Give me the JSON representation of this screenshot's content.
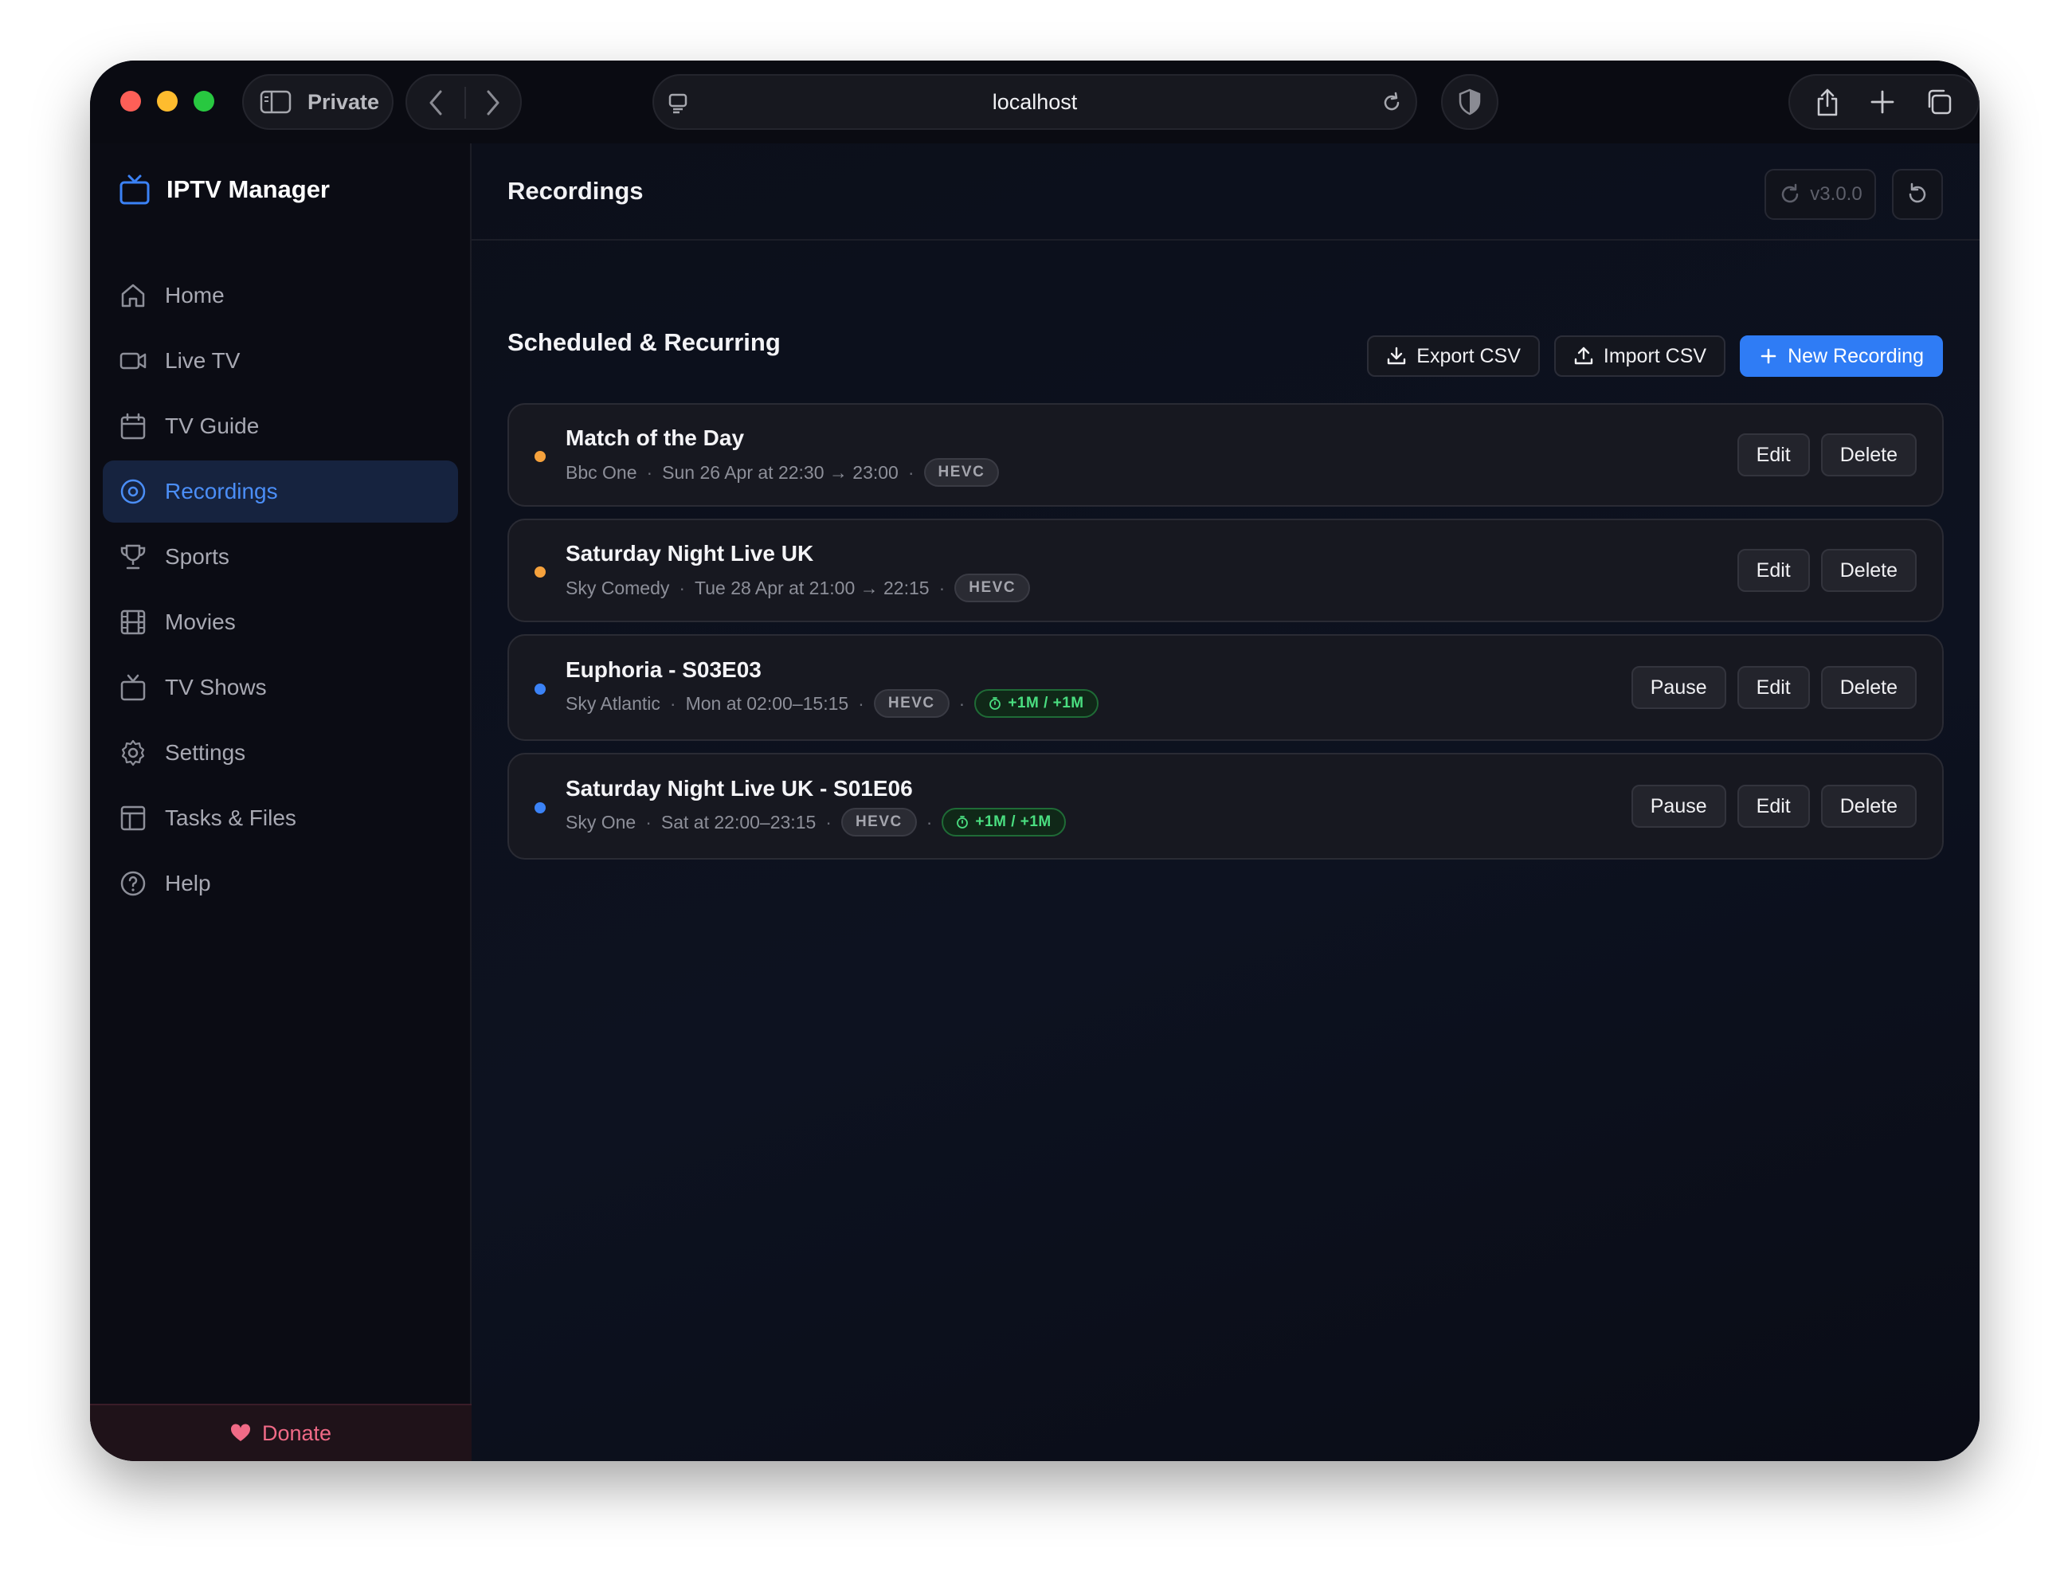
{
  "browser": {
    "private_label": "Private",
    "url": "localhost"
  },
  "app": {
    "name": "IPTV Manager",
    "accent_color": "#2f7cf5"
  },
  "sidebar": {
    "items": [
      {
        "label": "Home",
        "icon": "home-icon",
        "active": false
      },
      {
        "label": "Live TV",
        "icon": "video-camera-icon",
        "active": false
      },
      {
        "label": "TV Guide",
        "icon": "calendar-icon",
        "active": false
      },
      {
        "label": "Recordings",
        "icon": "record-icon",
        "active": true
      },
      {
        "label": "Sports",
        "icon": "trophy-icon",
        "active": false
      },
      {
        "label": "Movies",
        "icon": "film-icon",
        "active": false
      },
      {
        "label": "TV Shows",
        "icon": "tv-icon",
        "active": false
      },
      {
        "label": "Settings",
        "icon": "gear-icon",
        "active": false
      },
      {
        "label": "Tasks & Files",
        "icon": "layout-icon",
        "active": false
      },
      {
        "label": "Help",
        "icon": "help-circle-icon",
        "active": false
      }
    ],
    "donate_label": "Donate"
  },
  "header": {
    "title": "Recordings",
    "version": "v3.0.0"
  },
  "section": {
    "title": "Scheduled & Recurring",
    "export_label": "Export CSV",
    "import_label": "Import CSV",
    "new_label": "New Recording"
  },
  "recordings": [
    {
      "title": "Match of the Day",
      "channel": "Bbc One",
      "schedule": "Sun 26 Apr at 22:30 → 23:00",
      "codec": "HEVC",
      "padding": "",
      "status_color": "orange",
      "actions": {
        "pause": "",
        "edit": "Edit",
        "delete": "Delete"
      }
    },
    {
      "title": "Saturday Night Live UK",
      "channel": "Sky Comedy",
      "schedule": "Tue 28 Apr at 21:00 → 22:15",
      "codec": "HEVC",
      "padding": "",
      "status_color": "orange",
      "actions": {
        "pause": "",
        "edit": "Edit",
        "delete": "Delete"
      }
    },
    {
      "title": "Euphoria - S03E03",
      "channel": "Sky Atlantic",
      "schedule": "Mon at 02:00–15:15",
      "codec": "HEVC",
      "padding": "+1M / +1M",
      "status_color": "blue",
      "actions": {
        "pause": "Pause",
        "edit": "Edit",
        "delete": "Delete"
      }
    },
    {
      "title": "Saturday Night Live UK - S01E06",
      "channel": "Sky One",
      "schedule": "Sat at 22:00–23:15",
      "codec": "HEVC",
      "padding": "+1M / +1M",
      "status_color": "blue",
      "actions": {
        "pause": "Pause",
        "edit": "Edit",
        "delete": "Delete"
      }
    }
  ],
  "separator": "·"
}
